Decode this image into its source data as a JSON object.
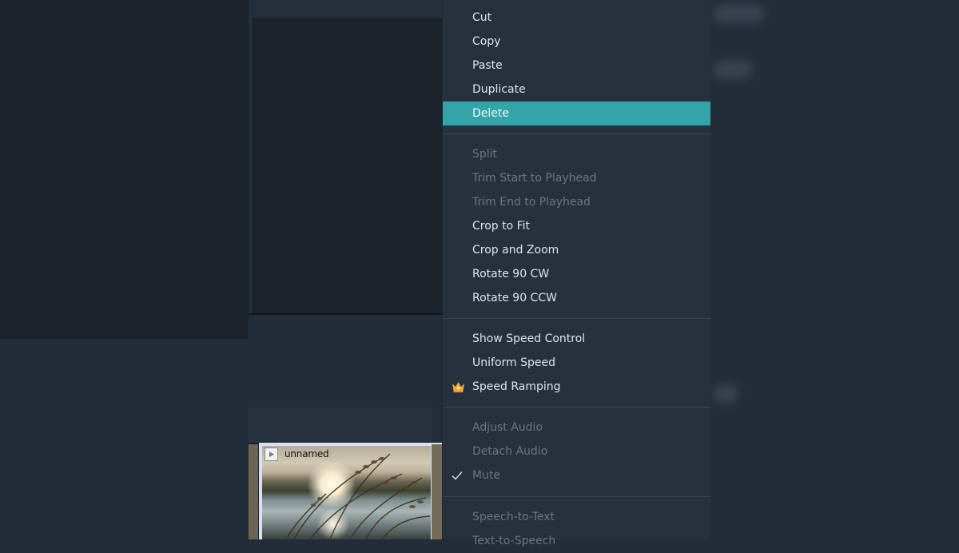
{
  "clip": {
    "name": "unnamed"
  },
  "menu": {
    "items": [
      {
        "label": "Cut",
        "state": "enabled"
      },
      {
        "label": "Copy",
        "state": "enabled"
      },
      {
        "label": "Paste",
        "state": "enabled"
      },
      {
        "label": "Duplicate",
        "state": "enabled"
      },
      {
        "label": "Delete",
        "state": "highlighted"
      },
      {
        "label": "Split",
        "state": "disabled"
      },
      {
        "label": "Trim Start to Playhead",
        "state": "disabled"
      },
      {
        "label": "Trim End to Playhead",
        "state": "disabled"
      },
      {
        "label": "Crop to Fit",
        "state": "enabled"
      },
      {
        "label": "Crop and Zoom",
        "state": "enabled"
      },
      {
        "label": "Rotate 90 CW",
        "state": "enabled"
      },
      {
        "label": "Rotate 90 CCW",
        "state": "enabled"
      },
      {
        "label": "Show Speed Control",
        "state": "enabled"
      },
      {
        "label": "Uniform Speed",
        "state": "enabled"
      },
      {
        "label": "Speed Ramping",
        "state": "enabled",
        "icon": "crown-icon"
      },
      {
        "label": "Adjust Audio",
        "state": "disabled"
      },
      {
        "label": "Detach Audio",
        "state": "disabled"
      },
      {
        "label": "Mute",
        "state": "disabled",
        "checked": true,
        "icon": "checkmark-icon"
      },
      {
        "label": "Speech-to-Text",
        "state": "disabled"
      },
      {
        "label": "Text-to-Speech",
        "state": "disabled"
      }
    ]
  },
  "colors": {
    "menu_bg": "#27313d",
    "highlight": "#35a4a8",
    "text_enabled": "#dfe4ea",
    "text_disabled": "#6b7683",
    "crown": "#f2a93b"
  }
}
